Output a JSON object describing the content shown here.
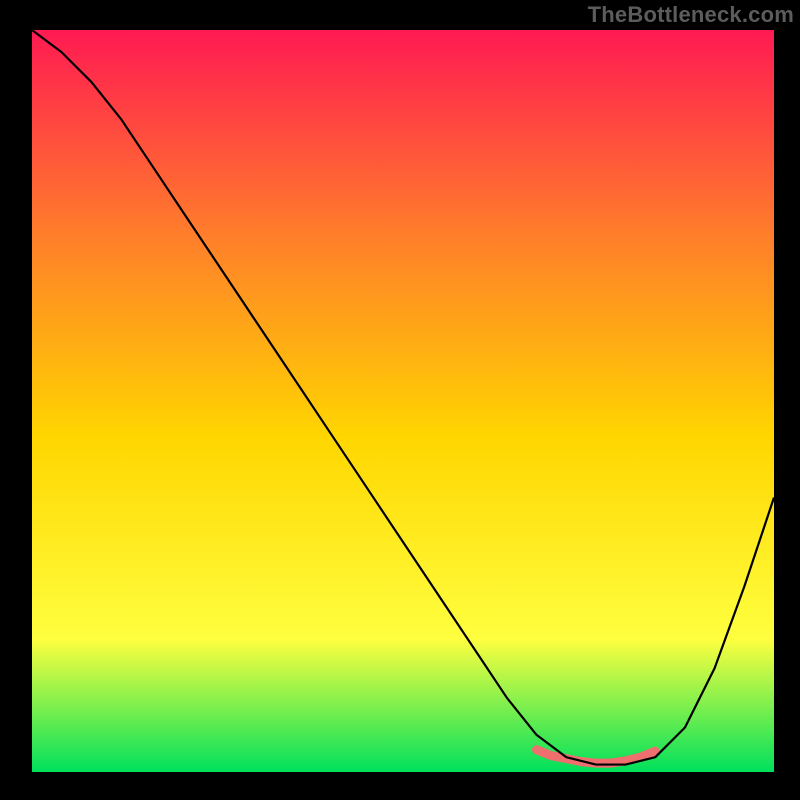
{
  "watermark": "TheBottleneck.com",
  "chart_data": {
    "type": "line",
    "title": "",
    "xlabel": "",
    "ylabel": "",
    "xlim": [
      0,
      100
    ],
    "ylim": [
      0,
      100
    ],
    "grid": false,
    "gradient_background": {
      "top": "#ff1a52",
      "mid_upper": "#ff7f2a",
      "mid": "#ffd600",
      "mid_lower": "#ffff3f",
      "bottom": "#00e05c"
    },
    "series": [
      {
        "name": "bottleneck-curve",
        "color": "#000000",
        "stroke_width": 2.2,
        "x": [
          0,
          4,
          8,
          12,
          16,
          20,
          24,
          28,
          32,
          36,
          40,
          44,
          48,
          52,
          56,
          60,
          64,
          68,
          72,
          76,
          80,
          84,
          88,
          92,
          96,
          100
        ],
        "y": [
          100,
          97,
          93,
          88,
          82,
          76,
          70,
          64,
          58,
          52,
          46,
          40,
          34,
          28,
          22,
          16,
          10,
          5,
          2,
          1,
          1,
          2,
          6,
          14,
          25,
          37
        ]
      },
      {
        "name": "optimal-zone-highlight",
        "color": "#ef6f6f",
        "stroke_width": 9,
        "linecap": "round",
        "x": [
          68,
          70,
          72,
          74,
          76,
          78,
          80,
          82,
          84
        ],
        "y": [
          3,
          2.2,
          1.8,
          1.4,
          1.2,
          1.2,
          1.5,
          2.0,
          2.8
        ]
      }
    ]
  }
}
